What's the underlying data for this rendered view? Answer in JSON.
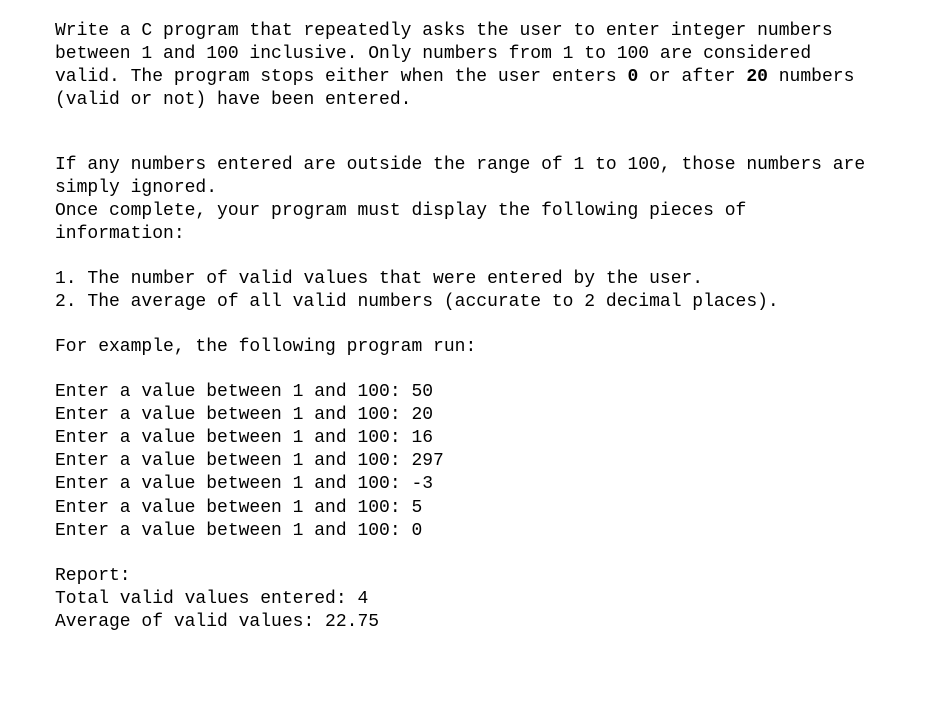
{
  "intro": {
    "p1_part1": "Write a C program that repeatedly asks the user to enter integer numbers between 1 and 100 inclusive. Only numbers from 1 to 100 are considered valid. The program stops either when the user enters ",
    "p1_bold1": "0",
    "p1_part2": " or after ",
    "p1_bold2": "20",
    "p1_part3": " numbers (valid or not) have been entered."
  },
  "ignore": {
    "p2": "If any numbers entered are outside the range of 1 to 100, those numbers are simply ignored.",
    "p3": "Once complete, your program must display the following pieces of information:"
  },
  "list": {
    "item1": "1. The number of valid values that were entered by the user.",
    "item2": "2. The average of all valid numbers (accurate to 2 decimal places)."
  },
  "example_intro": "For example, the following program run:",
  "run": {
    "l1": "Enter a value between 1 and 100: 50",
    "l2": "Enter a value between 1 and 100: 20",
    "l3": "Enter a value between 1 and 100: 16",
    "l4": "Enter a value between 1 and 100: 297",
    "l5": "Enter a value between 1 and 100: -3",
    "l6": "Enter a value between 1 and 100: 5",
    "l7": "Enter a value between 1 and 100: 0"
  },
  "report": {
    "header": "Report:",
    "total": "Total valid values entered: 4",
    "avg": "Average of valid values: 22.75"
  }
}
